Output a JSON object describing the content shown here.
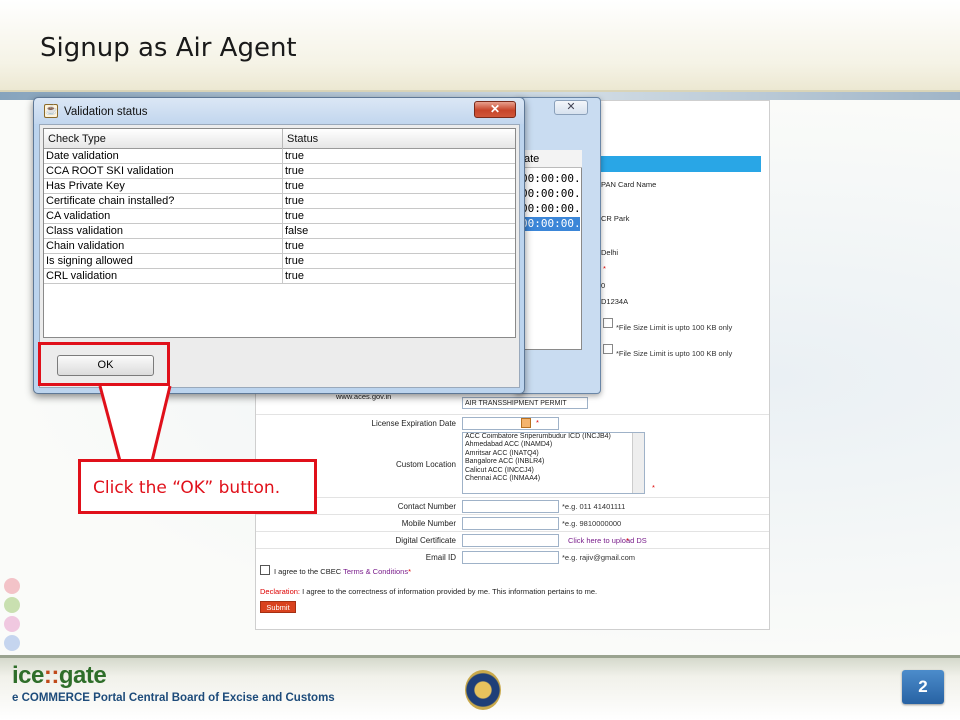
{
  "slide": {
    "title": "Signup as Air Agent",
    "page_number": "2",
    "footer_logo": {
      "name": "ice",
      "separator": "::",
      "name2": "gate",
      "tagline": "e COMMERCE Portal Central Board of Excise and Customs"
    },
    "deco_colors": [
      "#f3c3c8",
      "#c9e0b0",
      "#f0c8e0",
      "#c5d5ef"
    ]
  },
  "dialog": {
    "title": "Validation status",
    "close_label": "✕",
    "columns": [
      "Check Type",
      "Status"
    ],
    "rows": [
      {
        "check": "Date validation",
        "status": "true"
      },
      {
        "check": "CCA ROOT SKI validation",
        "status": "true"
      },
      {
        "check": "Has Private Key",
        "status": "true"
      },
      {
        "check": "Certificate chain installed?",
        "status": "true"
      },
      {
        "check": "CA validation",
        "status": "true"
      },
      {
        "check": "Class validation",
        "status": "false"
      },
      {
        "check": "Chain validation",
        "status": "true"
      },
      {
        "check": "Is signing allowed",
        "status": "true"
      },
      {
        "check": "CRL validation",
        "status": "true"
      }
    ],
    "ok_label": "OK"
  },
  "background_dialog": {
    "close_label": "✕",
    "column_header": "ate",
    "cells": [
      "00:00:00...",
      "00:00:00...",
      "00:00:00...",
      "00:00:00..."
    ]
  },
  "form": {
    "partial_texts": [
      "PAN Card Name",
      "CR Park",
      "Delhi",
      "0",
      "D1234A"
    ],
    "file_hint": "*File Size Limit is upto 100 KB only",
    "website_partial": "www.aces.gov.in",
    "permit_select": "AIR TRANSSHIPMENT PERMIT",
    "license_label": "License Expiration Date",
    "custom_location_label": "Custom Location",
    "custom_locations": [
      "ACC Coimbatore Sriperumbudur ICD (INCJB4)",
      "Ahmedabad ACC (INAMD4)",
      "Amritsar ACC (INATQ4)",
      "Bangalore ACC (INBLR4)",
      "Calicut ACC (INCCJ4)",
      "Chennai ACC (INMAA4)"
    ],
    "contact_label": "Contact Number",
    "contact_hint": "*e.g. 011 41401111",
    "mobile_label": "Mobile Number",
    "mobile_hint": "*e.g. 9810000000",
    "digital_cert_label": "Digital Certificate",
    "upload_ds_link": "Click here to upload DS",
    "email_label": "Email ID",
    "email_hint": "*e.g. rajiv@gmail.com",
    "agree_text": "I agree to the CBEC",
    "agree_link": "Terms & Conditions",
    "declaration_label": "Declaration:",
    "declaration_text": "I agree to the correctness of information provided by me. This information pertains to me.",
    "submit_label": "Submit",
    "required_mark": "*"
  },
  "callout": {
    "text": "Click the “OK” button."
  },
  "colors": {
    "callout_red": "#e0101a",
    "form_header_blue": "#29a6e6",
    "submit_orange": "#d9421e"
  }
}
